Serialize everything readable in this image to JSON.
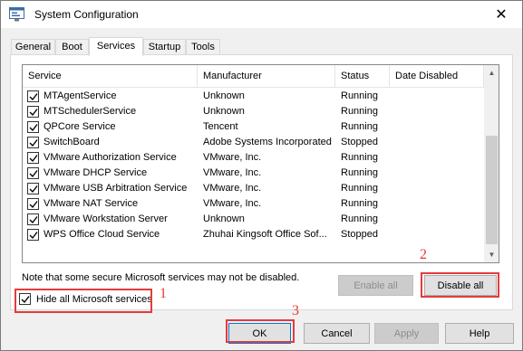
{
  "window": {
    "title": "System Configuration",
    "close_glyph": "✕"
  },
  "tabs": [
    {
      "label": "General"
    },
    {
      "label": "Boot"
    },
    {
      "label": "Services"
    },
    {
      "label": "Startup"
    },
    {
      "label": "Tools"
    }
  ],
  "services": {
    "columns": [
      "Service",
      "Manufacturer",
      "Status",
      "Date Disabled"
    ],
    "rows": [
      {
        "name": "MTAgentService",
        "manufacturer": "Unknown",
        "status": "Running",
        "date_disabled": "",
        "checked": true
      },
      {
        "name": "MTSchedulerService",
        "manufacturer": "Unknown",
        "status": "Running",
        "date_disabled": "",
        "checked": true
      },
      {
        "name": "QPCore Service",
        "manufacturer": "Tencent",
        "status": "Running",
        "date_disabled": "",
        "checked": true
      },
      {
        "name": "SwitchBoard",
        "manufacturer": "Adobe Systems Incorporated",
        "status": "Stopped",
        "date_disabled": "",
        "checked": true
      },
      {
        "name": "VMware Authorization Service",
        "manufacturer": "VMware, Inc.",
        "status": "Running",
        "date_disabled": "",
        "checked": true
      },
      {
        "name": "VMware DHCP Service",
        "manufacturer": "VMware, Inc.",
        "status": "Running",
        "date_disabled": "",
        "checked": true
      },
      {
        "name": "VMware USB Arbitration Service",
        "manufacturer": "VMware, Inc.",
        "status": "Running",
        "date_disabled": "",
        "checked": true
      },
      {
        "name": "VMware NAT Service",
        "manufacturer": "VMware, Inc.",
        "status": "Running",
        "date_disabled": "",
        "checked": true
      },
      {
        "name": "VMware Workstation Server",
        "manufacturer": "Unknown",
        "status": "Running",
        "date_disabled": "",
        "checked": true
      },
      {
        "name": "WPS Office Cloud Service",
        "manufacturer": "Zhuhai Kingsoft Office Sof...",
        "status": "Stopped",
        "date_disabled": "",
        "checked": true
      }
    ]
  },
  "note": "Note that some secure Microsoft services may not be disabled.",
  "hide_ms": {
    "label": "Hide all Microsoft services",
    "checked": true
  },
  "buttons": {
    "enable_all": "Enable all",
    "disable_all": "Disable all",
    "ok": "OK",
    "cancel": "Cancel",
    "apply": "Apply",
    "help": "Help"
  },
  "callouts": [
    "1",
    "2",
    "3"
  ],
  "colors": {
    "highlight": "#e43b3b",
    "accent": "#0078d7"
  },
  "icons": [
    "system-configuration-icon",
    "close-icon",
    "checkbox-checked-icon",
    "scroll-up-arrow-icon",
    "scroll-down-arrow-icon"
  ]
}
